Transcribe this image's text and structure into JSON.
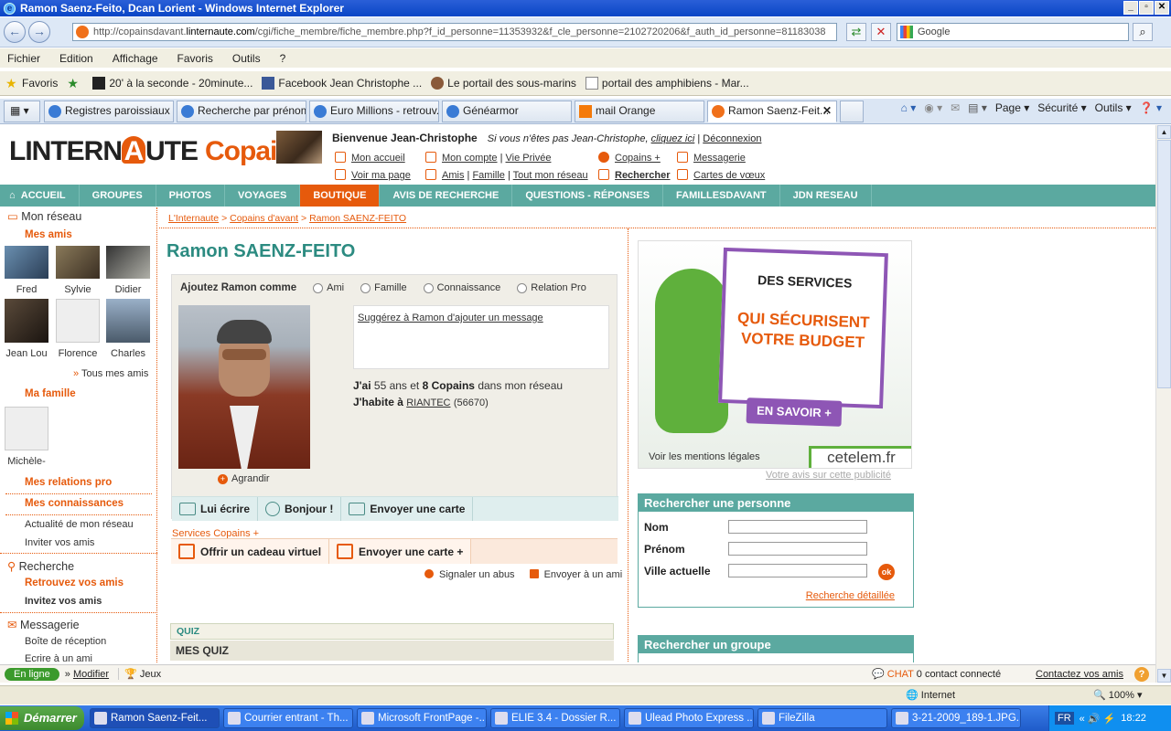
{
  "window": {
    "title": "Ramon Saenz-Feito, Dcan Lorient - Windows Internet Explorer",
    "url_prefix": "http://copainsdavant.",
    "url_domain": "linternaute.com",
    "url_rest": "/cgi/fiche_membre/fiche_membre.php?f_id_personne=11353932&f_cle_personne=2102720206&f_auth_id_personne=81183038",
    "search_placeholder": "Google"
  },
  "menu": [
    "Fichier",
    "Edition",
    "Affichage",
    "Favoris",
    "Outils",
    "?"
  ],
  "favorites": {
    "label": "Favoris",
    "items": [
      "20' à la seconde - 20minute...",
      "Facebook  Jean Christophe ...",
      "Le portail des sous-marins",
      "portail des amphibiens - Mar..."
    ]
  },
  "tabs": [
    {
      "label": "Registres paroissiaux ..."
    },
    {
      "label": "Recherche par prénom..."
    },
    {
      "label": "Euro Millions - retrouv..."
    },
    {
      "label": "Généarmor"
    },
    {
      "label": "mail Orange"
    },
    {
      "label": "Ramon Saenz-Feit..."
    }
  ],
  "commandbar": [
    "Page",
    "Sécurité",
    "Outils"
  ],
  "site": {
    "logo_left": "LINTERN",
    "logo_a": "A",
    "logo_right": "UTE",
    "logo_copains": "Copains",
    "welcome": "Bienvenue Jean-Christophe",
    "not_you": "Si vous n'êtes pas Jean-Christophe,",
    "click_here": "cliquez ici",
    "sep": "|",
    "logout": "Déconnexion",
    "links": {
      "mon_accueil": "Mon accueil",
      "voir_ma_page": "Voir ma page",
      "mon_compte": "Mon compte",
      "vie_privee": "Vie Privée",
      "amis": "Amis",
      "famille": "Famille",
      "tout_mon_reseau": "Tout mon réseau",
      "copains_plus": "Copains +",
      "rechercher": "Rechercher",
      "messagerie": "Messagerie",
      "cartes_voeux": "Cartes de vœux"
    },
    "nav": [
      "ACCUEIL",
      "GROUPES",
      "PHOTOS",
      "VOYAGES",
      "BOUTIQUE",
      "AVIS DE RECHERCHE",
      "QUESTIONS - RÉPONSES",
      "FAMILLESDAVANT",
      "JDN RESEAU"
    ]
  },
  "left": {
    "mon_reseau": "Mon réseau",
    "mes_amis": "Mes amis",
    "friends": [
      "Fred",
      "Sylvie",
      "Didier",
      "Jean Lou",
      "Florence",
      "Charles"
    ],
    "tous_mes_amis": "Tous mes amis",
    "ma_famille": "Ma famille",
    "family": [
      "Michèle-"
    ],
    "mes_relations_pro": "Mes relations pro",
    "mes_connaissances": "Mes connaissances",
    "actualite": "Actualité de mon réseau",
    "inviter": "Inviter vos amis",
    "recherche": "Recherche",
    "retrouvez": "Retrouvez vos amis",
    "invitez": "Invitez vos amis",
    "messagerie": "Messagerie",
    "boite": "Boîte de réception",
    "ecrire": "Ecrire à un ami"
  },
  "main": {
    "breadcrumb": [
      "L'Internaute",
      "Copains d'avant",
      "Ramon SAENZ-FEITO"
    ],
    "breadcrumb_sep": ">",
    "name": "Ramon SAENZ-FEITO",
    "add_as": "Ajoutez Ramon comme",
    "relations": [
      "Ami",
      "Famille",
      "Connaissance",
      "Relation Pro"
    ],
    "agrandir": "Agrandir",
    "suggest": "Suggérez à Ramon d'ajouter un message",
    "age_label": "J'ai",
    "age_value": "55 ans et",
    "copains_count": "8 Copains",
    "reseau_text": "dans mon réseau",
    "habite_label": "J'habite à",
    "city": "RIANTEC",
    "postcode": "(56670)",
    "actions": [
      "Lui écrire",
      "Bonjour !",
      "Envoyer une carte"
    ],
    "services_title": "Services Copains +",
    "services": [
      "Offrir un cadeau virtuel",
      "Envoyer une carte +"
    ],
    "signaler": "Signaler un abus",
    "envoyer_ami": "Envoyer à un ami",
    "quiz_bar": "QUIZ",
    "quiz_title": "MES QUIZ"
  },
  "ad": {
    "line1": "DES SERVICES",
    "line2": "QUI SÉCURISENT",
    "line3": "VOTRE BUDGET",
    "button": "EN SAVOIR +",
    "mentions": "Voir les mentions légales",
    "brand": "cetelem.fr",
    "avis": "Votre avis sur cette publicité"
  },
  "search": {
    "title": "Rechercher une personne",
    "nom": "Nom",
    "prenom": "Prénom",
    "ville": "Ville actuelle",
    "ok": "ok",
    "detail": "Recherche détaillée",
    "group_title": "Rechercher un groupe"
  },
  "messenger": {
    "status": "En ligne",
    "modifier": "Modifier",
    "jeux": "Jeux",
    "chat": "CHAT",
    "contacts": "0 contact connecté",
    "contactez": "Contactez vos amis"
  },
  "status": {
    "zone": "Internet",
    "zoom": "100%"
  },
  "taskbar": {
    "start": "Démarrer",
    "tasks": [
      "Ramon Saenz-Feit...",
      "Courrier entrant - Th...",
      "Microsoft FrontPage -...",
      "ELIE 3.4 - Dossier  R...",
      "Ulead Photo Express ...",
      "FileZilla",
      "3-21-2009_189-1.JPG..."
    ],
    "lang": "FR",
    "time": "18:22"
  }
}
